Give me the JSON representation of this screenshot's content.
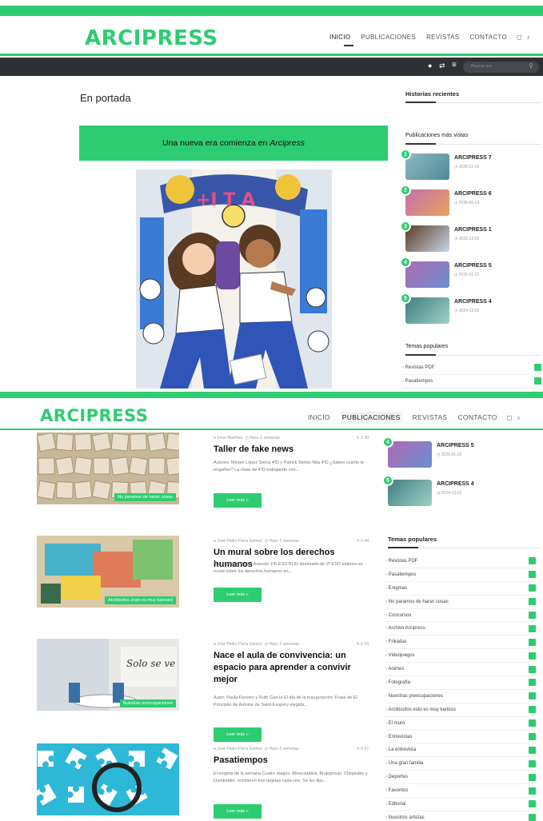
{
  "brand": {
    "logo": "ARCIPRESS",
    "accent": "#2ecc71",
    "dark_bar": "#2d3035"
  },
  "nav": {
    "items": [
      "INICIO",
      "PUBLICACIONES",
      "REVISTAS",
      "CONTACTO"
    ],
    "search_placeholder": "Buscar por"
  },
  "main": {
    "section_title": "En portada",
    "featured_title_plain": "Una nueva era comienza en ",
    "featured_title_em": "Arcipress"
  },
  "sidebar": {
    "recent_title": "Historias recientes",
    "popular_title": "Publicaciones más vistas",
    "popular": [
      {
        "rank": "1",
        "title": "ARCIPRESS 7",
        "date": "2025-11-15"
      },
      {
        "rank": "2",
        "title": "ARCIPRESS 6",
        "date": "2025-06-03"
      },
      {
        "rank": "3",
        "title": "ARCIPRESS 1",
        "date": "2022-12-22"
      },
      {
        "rank": "4",
        "title": "ARCIPRESS 5",
        "date": "2025-01-22"
      },
      {
        "rank": "5",
        "title": "ARCIPRESS 4",
        "date": "2024-12-22"
      }
    ],
    "topics_title": "Temas populares",
    "topics_top": [
      "Revistas PDF",
      "Pasatiempos"
    ]
  },
  "sidebar2": {
    "popular": [
      {
        "rank": "4",
        "title": "ARCIPRESS 5",
        "date": "2025-01-22"
      },
      {
        "rank": "5",
        "title": "ARCIPRESS 4",
        "date": "2024-12-22"
      }
    ],
    "topics_title": "Temas populares",
    "topics": [
      "Revistas PDF",
      "Pasatiempos",
      "Enigmas",
      "No paramos de hacer cosas",
      "Concursos",
      "Archivo Arcipress",
      "Frikadas",
      "Videojuegos",
      "Animes",
      "Fotografía",
      "Nuestras preocupaciones",
      "Arcilósofos esto es muy karioso",
      "El muro",
      "Entrevistas",
      "La entrevista",
      "Una gran familia",
      "Deportes",
      "Favoritos",
      "Editorial",
      "Nuestros artistas"
    ]
  },
  "posts": [
    {
      "author": "Irene Martínez",
      "time": "Hace 2 semanas",
      "stats": "0  30",
      "title": "Taller de fake news",
      "excerpt": "Autores: Miriam López Sierra 4ºD y Patrick Stefan Nita 4ºD ¿Sabes cuánto te engañan? La clase de 4ºD trabajando con...",
      "button": "Leer más »",
      "badge": "No paramos de hacer cosas"
    },
    {
      "author": "José Pedro Parra Gómez",
      "time": "Hace 2 semanas",
      "stats": "0  44",
      "title": "Un mural sobre los derechos humanos",
      "excerpt": "Autor: Juanjo Badía Asensio 1ºE ESO B) El alumnado de 2º ESO elabora un mural sobre los derechos humanos en...",
      "button": "Leer más »",
      "badge": "Arcilósofos (esto es muy karioso)"
    },
    {
      "author": "José Pedro Parra Gómez",
      "time": "Hace 2 semanas",
      "stats": "0  34",
      "title": "Nace el aula de convivencia: un espacio para aprender a convivir mejor",
      "excerpt": "Autor: Paula Ferreiro y Ruth García El día de la inauguración: Frase de El Principito de Antoine de Saint-Exupéry elegida...",
      "button": "Leer más »",
      "badge": "Nuestras preocupaciones"
    },
    {
      "author": "José Pedro Parra Gómez",
      "time": "Hace 2 semanas",
      "stats": "0  37",
      "title": "Pasatiempos",
      "excerpt": "El enigma de la semana Cuatro magos, Abracadabra, Brujopinujo, Chiqarabo y Dumboldor, recibieron tres tarjetas cada uno. Se les dijo...",
      "button": "Leer más »",
      "badge": ""
    }
  ]
}
